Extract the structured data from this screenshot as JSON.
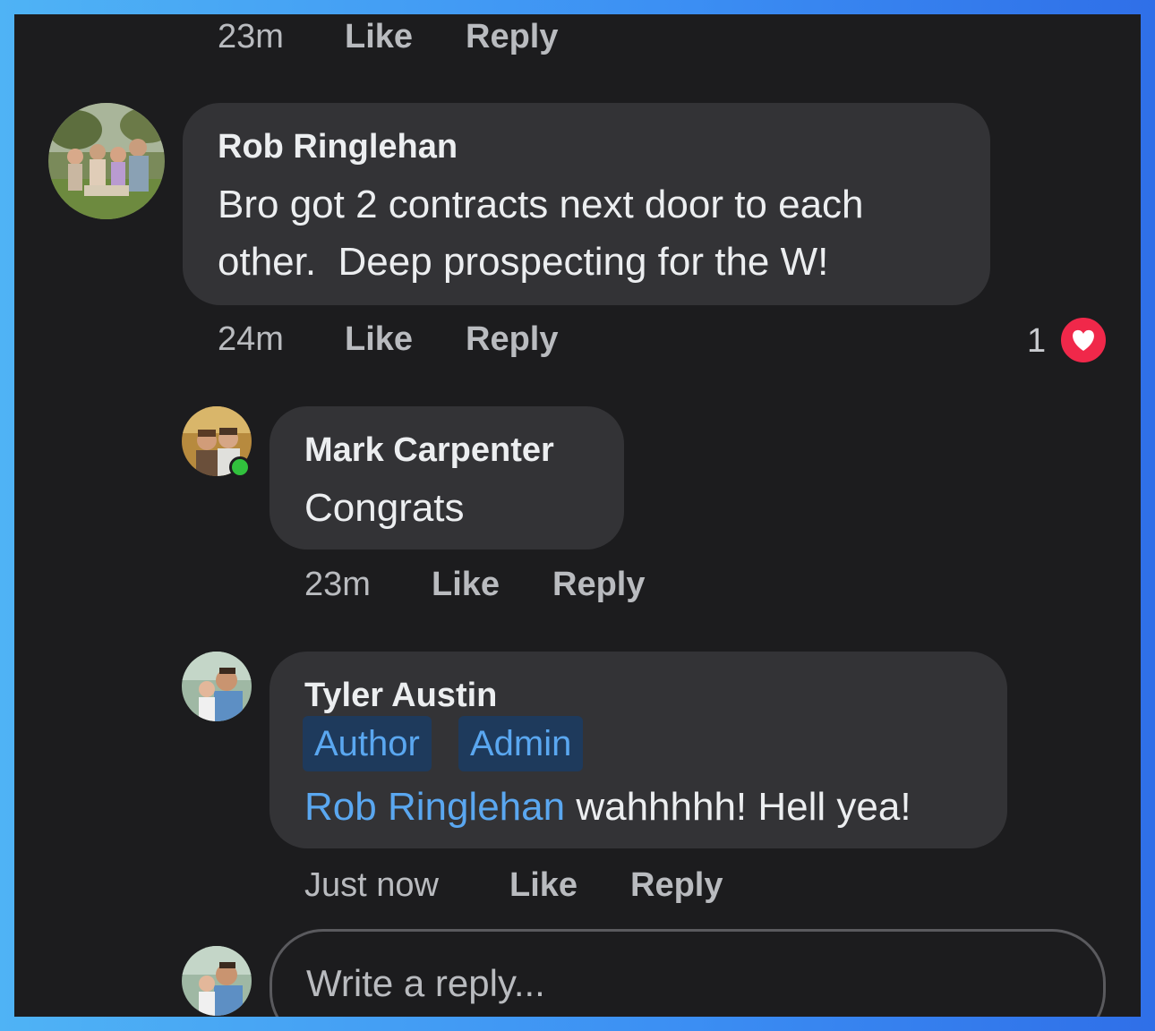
{
  "top_actions": {
    "time": "23m",
    "like": "Like",
    "reply": "Reply"
  },
  "comments": [
    {
      "author": "Rob Ringlehan",
      "text_line1": "Bro got 2 contracts next door to each",
      "text_line2": "other.  Deep prospecting for the W!",
      "time": "24m",
      "like": "Like",
      "reply": "Reply",
      "reaction_count": "1",
      "reaction_icon": "heart-icon"
    },
    {
      "author": "Mark Carpenter",
      "text": "Congrats",
      "time": "23m",
      "like": "Like",
      "reply": "Reply",
      "online": true
    },
    {
      "author": "Tyler Austin",
      "badges": [
        "Author",
        "Admin"
      ],
      "mention": "Rob Ringlehan",
      "text": " wahhhhh! Hell yea!",
      "time": "Just now",
      "like": "Like",
      "reply": "Reply"
    }
  ],
  "reply_input": {
    "placeholder": "Write a reply..."
  },
  "colors": {
    "background": "#1c1c1e",
    "bubble": "#333336",
    "link_blue": "#5aa7f0",
    "reaction_red": "#f0284a",
    "online_green": "#31c13d"
  }
}
